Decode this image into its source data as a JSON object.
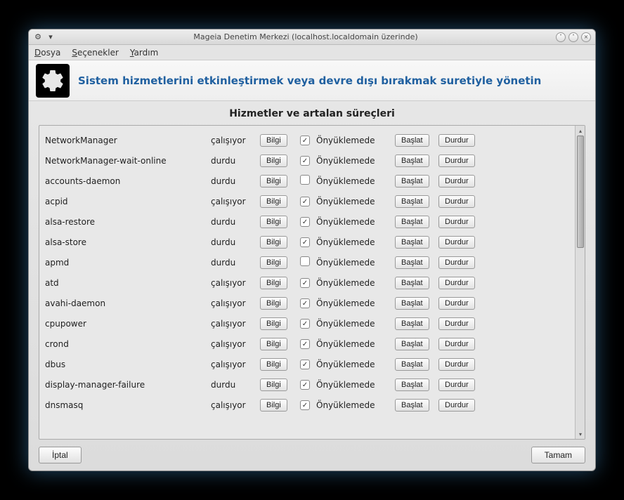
{
  "window": {
    "title": "Mageia Denetim Merkezi  (localhost.localdomain üzerinde)"
  },
  "menu": {
    "file": "Dosya",
    "options": "Seçenekler",
    "help": "Yardım"
  },
  "header": {
    "title": "Sistem hizmetlerini etkinleştirmek veya devre dışı bırakmak suretiyle yönetin"
  },
  "section": {
    "title": "Hizmetler ve artalan süreçleri"
  },
  "labels": {
    "info": "Bilgi",
    "onboot": "Önyüklemede",
    "start": "Başlat",
    "stop": "Durdur",
    "cancel": "İptal",
    "ok": "Tamam"
  },
  "status": {
    "running": "çalışıyor",
    "stopped": "durdu"
  },
  "services": [
    {
      "name": "NetworkManager",
      "status": "çalışıyor",
      "onboot": true
    },
    {
      "name": "NetworkManager-wait-online",
      "status": "durdu",
      "onboot": true
    },
    {
      "name": "accounts-daemon",
      "status": "durdu",
      "onboot": false
    },
    {
      "name": "acpid",
      "status": "çalışıyor",
      "onboot": true
    },
    {
      "name": "alsa-restore",
      "status": "durdu",
      "onboot": true
    },
    {
      "name": "alsa-store",
      "status": "durdu",
      "onboot": true
    },
    {
      "name": "apmd",
      "status": "durdu",
      "onboot": false
    },
    {
      "name": "atd",
      "status": "çalışıyor",
      "onboot": true
    },
    {
      "name": "avahi-daemon",
      "status": "çalışıyor",
      "onboot": true
    },
    {
      "name": "cpupower",
      "status": "çalışıyor",
      "onboot": true
    },
    {
      "name": "crond",
      "status": "çalışıyor",
      "onboot": true
    },
    {
      "name": "dbus",
      "status": "çalışıyor",
      "onboot": true
    },
    {
      "name": "display-manager-failure",
      "status": "durdu",
      "onboot": true
    },
    {
      "name": "dnsmasq",
      "status": "çalışıyor",
      "onboot": true
    }
  ]
}
